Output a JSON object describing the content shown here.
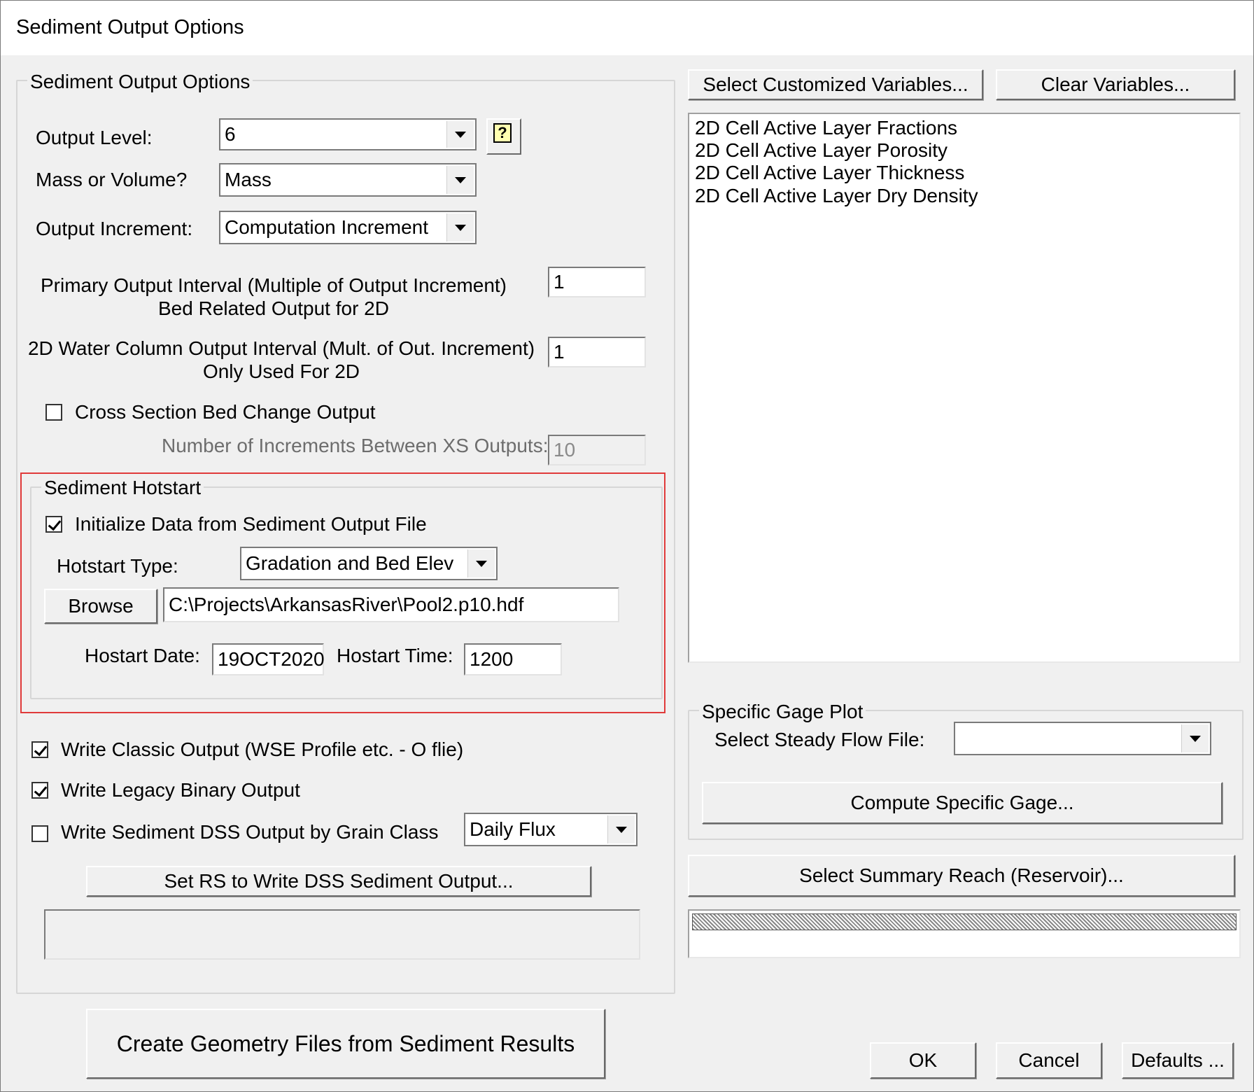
{
  "window": {
    "title": "Sediment Output Options"
  },
  "left": {
    "group_caption": "Sediment Output Options",
    "output_level_label": "Output Level:",
    "output_level_value": "6",
    "help_glyph": "?",
    "mass_volume_label": "Mass or Volume?",
    "mass_volume_value": "Mass",
    "output_increment_label": "Output Increment:",
    "output_increment_value": "Computation Increment",
    "primary_interval_label_1": "Primary Output Interval (Multiple of Output Increment)",
    "primary_interval_label_2": "Bed Related Output for 2D",
    "primary_interval_value": "1",
    "water_column_label_1": "2D Water Column Output Interval (Mult. of Out. Increment)",
    "water_column_label_2": "Only Used For 2D",
    "water_column_value": "1",
    "xs_bed_change_label": "Cross Section Bed Change Output",
    "xs_bed_change_checked": false,
    "increments_between_label": "Number of Increments Between XS Outputs:",
    "increments_between_value": "10"
  },
  "hotstart": {
    "caption": "Sediment Hotstart",
    "initialize_label": "Initialize Data from Sediment Output File",
    "initialize_checked": true,
    "type_label": "Hotstart Type:",
    "type_value": "Gradation and Bed Elev",
    "browse_label": "Browse",
    "file_path": "C:\\Projects\\ArkansasRiver\\Pool2.p10.hdf",
    "date_label": "Hostart Date:",
    "date_value": "19OCT2020",
    "time_label": "Hostart Time:",
    "time_value": "1200"
  },
  "outputs": {
    "classic_label": "Write Classic Output (WSE Profile etc. - O flie)",
    "classic_checked": true,
    "legacy_label": "Write Legacy Binary Output",
    "legacy_checked": true,
    "dss_grain_label": "Write Sediment DSS Output by Grain Class",
    "dss_grain_checked": false,
    "dss_grain_select": "Daily Flux",
    "set_rs_button": "Set RS to Write DSS Sediment Output...",
    "set_rs_text": ""
  },
  "right": {
    "select_vars_button": "Select Customized Variables...",
    "clear_vars_button": "Clear Variables...",
    "variables": [
      "2D Cell Active Layer Fractions",
      "2D Cell Active Layer Porosity",
      "2D Cell Active Layer Thickness",
      "2D Cell Active Layer Dry Density"
    ],
    "gage_caption": "Specific Gage Plot",
    "steady_flow_label": "Select Steady Flow File:",
    "steady_flow_value": "",
    "compute_gage_button": "Compute Specific Gage...",
    "summary_reach_button": "Select Summary Reach (Reservoir)..."
  },
  "footer": {
    "create_geometry_button": "Create Geometry Files from Sediment Results",
    "ok_button": "OK",
    "cancel_button": "Cancel",
    "defaults_button": "Defaults ..."
  },
  "colors": {
    "highlight_border": "#e03a3a",
    "dialog_bg": "#f0f0f0"
  }
}
